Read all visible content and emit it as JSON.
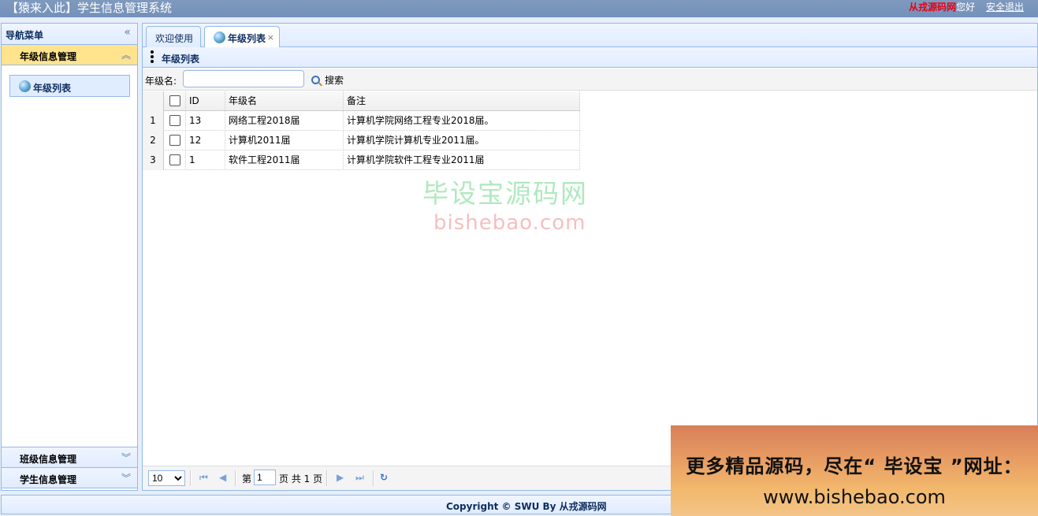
{
  "app": {
    "title": "【猿来入此】学生信息管理系统",
    "user": "从戎源码网",
    "greeting": "您好",
    "logout": "安全退出"
  },
  "west": {
    "title": "导航菜单",
    "sections": [
      {
        "label": "年级信息管理",
        "expanded": true,
        "items": [
          {
            "label": "年级列表"
          }
        ]
      },
      {
        "label": "班级信息管理",
        "expanded": false
      },
      {
        "label": "学生信息管理",
        "expanded": false
      }
    ]
  },
  "tabs": [
    {
      "label": "欢迎使用",
      "active": false
    },
    {
      "label": "年级列表",
      "active": true,
      "closable": true
    }
  ],
  "panel": {
    "title": "年级列表"
  },
  "toolbar": {
    "name_label": "年级名:",
    "name_value": "",
    "search_label": "搜索"
  },
  "grid": {
    "columns": [
      "ID",
      "年级名",
      "备注"
    ],
    "rows": [
      {
        "num": "1",
        "id": "13",
        "name": "网络工程2018届",
        "note": "计算机学院网络工程专业2018届。"
      },
      {
        "num": "2",
        "id": "12",
        "name": "计算机2011届",
        "note": "计算机学院计算机专业2011届。"
      },
      {
        "num": "3",
        "id": "1",
        "name": "软件工程2011届",
        "note": "计算机学院软件工程专业2011届"
      }
    ]
  },
  "pager": {
    "page_size": "10",
    "page_prefix": "第",
    "page_value": "1",
    "page_suffix": "页 共 1 页"
  },
  "footer": {
    "copyright": "Copyright © SWU By 从戎源码网"
  },
  "watermark": {
    "cn": "毕设宝源码网",
    "url": "bishebao.com",
    "ad_line1": "更多精品源码，尽在“ 毕设宝 ”网址：",
    "ad_line2": "www.bishebao.com"
  }
}
